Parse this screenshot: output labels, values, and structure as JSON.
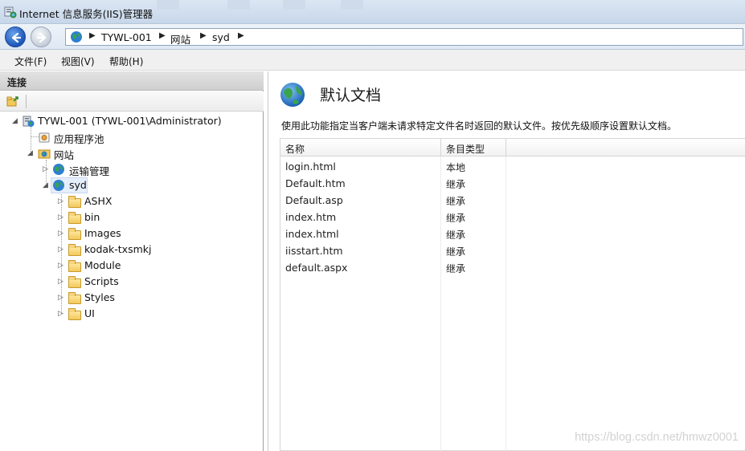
{
  "window": {
    "title": "Internet 信息服务(IIS)管理器"
  },
  "address": {
    "crumbs": [
      "TYWL-001",
      "网站",
      "syd"
    ]
  },
  "menu": [
    "文件(F)",
    "视图(V)",
    "帮助(H)"
  ],
  "connections": {
    "header": "连接",
    "tree": {
      "server": "TYWL-001 (TYWL-001\\Administrator)",
      "app_pools": "应用程序池",
      "sites": "网站",
      "site_transport": "运输管理",
      "site_selected": "syd",
      "folders": [
        "ASHX",
        "bin",
        "Images",
        "kodak-txsmkj",
        "Module",
        "Scripts",
        "Styles",
        "UI"
      ]
    }
  },
  "feature": {
    "title": "默认文档",
    "description": "使用此功能指定当客户端未请求特定文件名时返回的默认文件。按优先级顺序设置默认文档。",
    "columns": [
      "名称",
      "条目类型"
    ],
    "rows": [
      {
        "name": "login.html",
        "type": "本地"
      },
      {
        "name": "Default.htm",
        "type": "继承"
      },
      {
        "name": "Default.asp",
        "type": "继承"
      },
      {
        "name": "index.htm",
        "type": "继承"
      },
      {
        "name": "index.html",
        "type": "继承"
      },
      {
        "name": "iisstart.htm",
        "type": "继承"
      },
      {
        "name": "default.aspx",
        "type": "继承"
      }
    ]
  },
  "watermark": "https://blog.csdn.net/hmwz0001"
}
